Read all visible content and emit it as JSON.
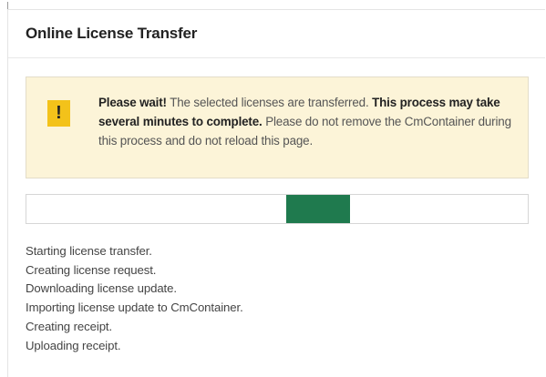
{
  "panel": {
    "title": "Online License Transfer"
  },
  "alert": {
    "icon": "exclamation-icon",
    "icon_glyph": "!",
    "strong_1": "Please wait!",
    "text_1": " The selected licenses are transferred. ",
    "strong_2": "This process may take several minutes to complete.",
    "text_2": " Please do not remove the CmContainer during this process and do not reload this page.",
    "background_color": "#fcf4d8",
    "icon_color": "#f3c21a"
  },
  "progress": {
    "state": "indeterminate",
    "fill_color": "#1f7a4e"
  },
  "log": {
    "lines": [
      "Starting license transfer.",
      "Creating license request.",
      "Downloading license update.",
      "Importing license update to CmContainer.",
      "Creating receipt.",
      "Uploading receipt."
    ]
  }
}
